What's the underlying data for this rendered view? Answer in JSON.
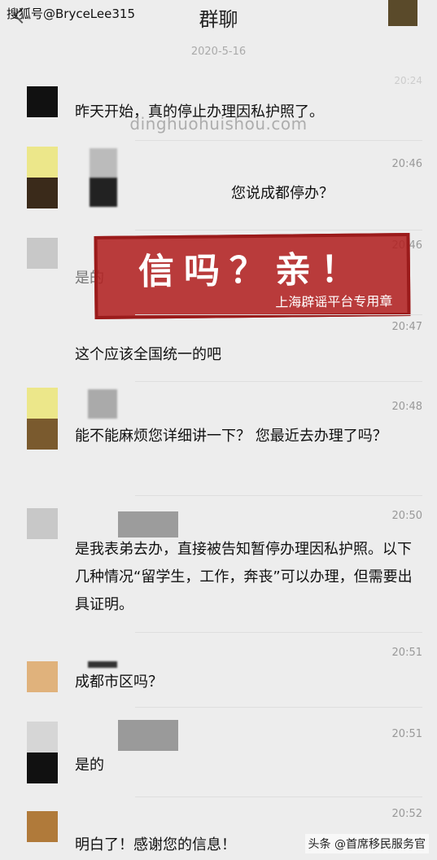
{
  "header": {
    "watermark": "搜狐号@BryceLee315",
    "title": "群聊"
  },
  "date_divider": "2020-5-16",
  "faded_time": "20:24",
  "site_watermark": "dinghuohuishou.com",
  "messages": [
    {
      "time": "",
      "text": "昨天开始，真的停止办理因私护照了。"
    },
    {
      "time": "20:46",
      "text": "您说成都停办？"
    },
    {
      "time": "20:46",
      "text": "是的"
    },
    {
      "time": "20:47",
      "text": "这个应该全国统一的吧"
    },
    {
      "time": "20:48",
      "text": "能不能麻烦您详细讲一下？ 您最近去办理了吗？"
    },
    {
      "time": "20:50",
      "text": "是我表弟去办，直接被告知暂停办理因私护照。以下几种情况“留学生，工作，奔丧”可以办理，但需要出具证明。"
    },
    {
      "time": "20:51",
      "text": "成都市区吗？"
    },
    {
      "time": "20:51",
      "text": "是的"
    },
    {
      "time": "20:52",
      "text": "明白了！感谢您的信息！"
    }
  ],
  "stamp": {
    "big_text": "信吗？亲！",
    "small_text": "上海辟谣平台专用章"
  },
  "bottom_watermark": "头条 @首席移民服务官"
}
